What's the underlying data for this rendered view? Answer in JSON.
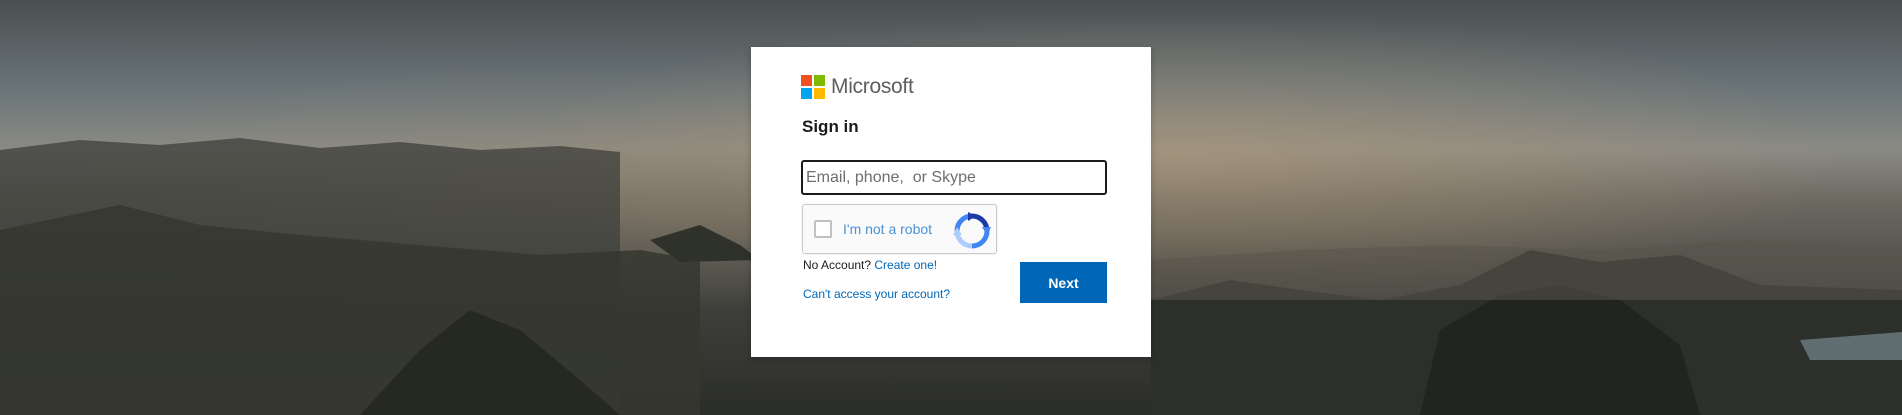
{
  "brand": {
    "name": "Microsoft",
    "colors": [
      "#f25022",
      "#7fba00",
      "#00a4ef",
      "#ffb900"
    ]
  },
  "signin": {
    "title": "Sign in",
    "email_placeholder": "Email, phone,  or Skype",
    "email_value": ""
  },
  "captcha": {
    "label": "I'm not a robot",
    "checked": false
  },
  "links": {
    "no_account_text": "No Account?",
    "create_label": "Create one!",
    "cant_access_label": "Can't access your account?"
  },
  "buttons": {
    "next_label": "Next"
  },
  "colors": {
    "accent": "#0067b8",
    "captcha_text": "#4b92d2"
  }
}
